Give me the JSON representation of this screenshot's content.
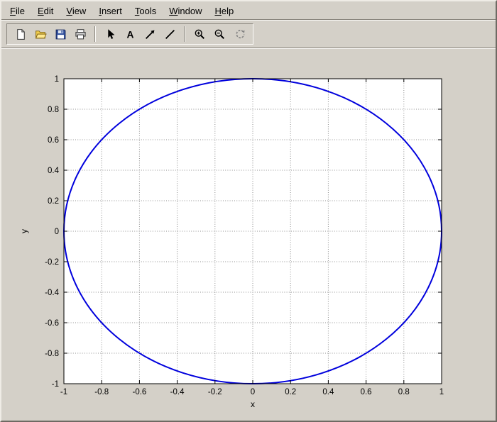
{
  "window": {
    "background": "#d4d0c8"
  },
  "menu": {
    "items": [
      "File",
      "Edit",
      "View",
      "Insert",
      "Tools",
      "Window",
      "Help"
    ]
  },
  "toolbar": {
    "groups": [
      [
        {
          "name": "new-figure",
          "icon": "new-document-icon"
        },
        {
          "name": "open-file",
          "icon": "open-folder-icon"
        },
        {
          "name": "save-figure",
          "icon": "save-icon"
        },
        {
          "name": "print-figure",
          "icon": "print-icon"
        }
      ],
      [
        {
          "name": "selection",
          "icon": "arrow-cursor-icon"
        },
        {
          "name": "add-text",
          "icon": "text-a-icon",
          "glyph": "A"
        },
        {
          "name": "add-arrow",
          "icon": "arrow-annotation-icon"
        },
        {
          "name": "add-line",
          "icon": "line-annotation-icon"
        }
      ],
      [
        {
          "name": "zoom-in",
          "icon": "zoom-in-icon"
        },
        {
          "name": "zoom-out",
          "icon": "zoom-out-icon"
        },
        {
          "name": "rotate-3d",
          "icon": "rotate-3d-icon"
        }
      ]
    ]
  },
  "chart_data": {
    "type": "line",
    "title": "",
    "xlabel": "x",
    "ylabel": "y",
    "xlim": [
      -1,
      1
    ],
    "ylim": [
      -1,
      1
    ],
    "xticks": [
      -1,
      -0.8,
      -0.6,
      -0.4,
      -0.2,
      0,
      0.2,
      0.4,
      0.6,
      0.8,
      1
    ],
    "yticks": [
      -1,
      -0.8,
      -0.6,
      -0.4,
      -0.2,
      0,
      0.2,
      0.4,
      0.6,
      0.8,
      1
    ],
    "grid": true,
    "grid_style": "dotted",
    "frame": "box",
    "legend": "none",
    "series": [
      {
        "name": "unit-circle",
        "shape": "circle",
        "center": [
          0,
          0
        ],
        "radius": 1,
        "color": "#0000dd",
        "linewidth": 2
      }
    ]
  }
}
